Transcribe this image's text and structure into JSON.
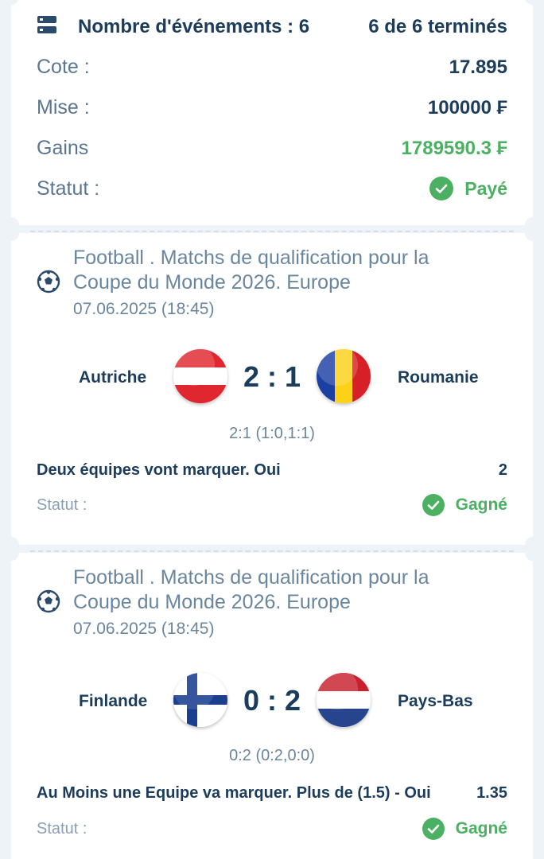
{
  "summary": {
    "events_label": "Nombre d'événements : 6",
    "events_done": "6 de 6 terminés",
    "odds_label": "Cote :",
    "odds_value": "17.895",
    "stake_label": "Mise :",
    "stake_value": "100000 ₣",
    "win_label": "Gains",
    "win_value": "1789590.3 ₣",
    "status_label": "Statut :",
    "status_value": "Payé"
  },
  "events": [
    {
      "league": "Football . Matchs de qualification pour la Coupe du Monde 2026. Europe",
      "league_line1": "Football . Matchs de qualification pour la",
      "league_line2": "Coupe du Monde 2026. Europe",
      "date": "07.06.2025 (18:45)",
      "home": "Autriche",
      "away": "Roumanie",
      "score": "2 : 1",
      "detail": "2:1 (1:0,1:1)",
      "market": "Deux équipes vont marquer. Oui",
      "odds": "2",
      "status_label": "Statut :",
      "status_value": "Gagné",
      "home_flag_icon": "austria-flag-icon",
      "away_flag_icon": "romania-flag-icon"
    },
    {
      "league": "Football . Matchs de qualification pour la Coupe du Monde 2026. Europe",
      "league_line1": "Football . Matchs de qualification pour la",
      "league_line2": "Coupe du Monde 2026. Europe",
      "date": "07.06.2025 (18:45)",
      "home": "Finlande",
      "away": "Pays-Bas",
      "score": "0 : 2",
      "detail": "0:2 (0:2,0:0)",
      "market": "Au Moins une Equipe va marquer. Plus de (1.5) - Oui",
      "odds": "1.35",
      "status_label": "Statut :",
      "status_value": "Gagné",
      "home_flag_icon": "finland-flag-icon",
      "away_flag_icon": "netherlands-flag-icon"
    }
  ],
  "colors": {
    "primary_text": "#1c3c5c",
    "muted_text": "#5b7690",
    "success": "#4cb063",
    "background": "#eef3f8"
  }
}
